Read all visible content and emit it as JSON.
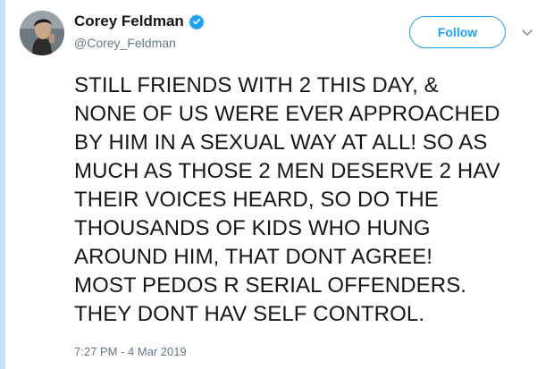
{
  "author": {
    "display_name": "Corey Feldman",
    "handle": "@Corey_Feldman",
    "verified": true
  },
  "icons": {
    "avatar": "profile-photo",
    "verified": "verified-badge-icon",
    "menu": "chevron-down-icon"
  },
  "actions": {
    "follow_label": "Follow"
  },
  "tweet": {
    "lines": [
      "STILL FRIENDS WITH 2 THIS DAY, &",
      "NONE OF US WERE EVER APPROACHED",
      "BY HIM IN A SEXUAL WAY AT ALL! SO AS",
      "MUCH AS THOSE 2 MEN DESERVE 2 HAV",
      "THEIR VOICES HEARD, SO DO THE",
      "THOUSANDS OF KIDS WHO HUNG",
      "AROUND HIM, THAT DONT AGREE!",
      "MOST PEDOS R SERIAL OFFENDERS.",
      "THEY DONT HAV SELF CONTROL."
    ],
    "timestamp": "7:27 PM - 4 Mar 2019"
  },
  "colors": {
    "accent": "#1da1f2",
    "secondary_text": "#657786",
    "left_rule": "#c4e2f4"
  }
}
